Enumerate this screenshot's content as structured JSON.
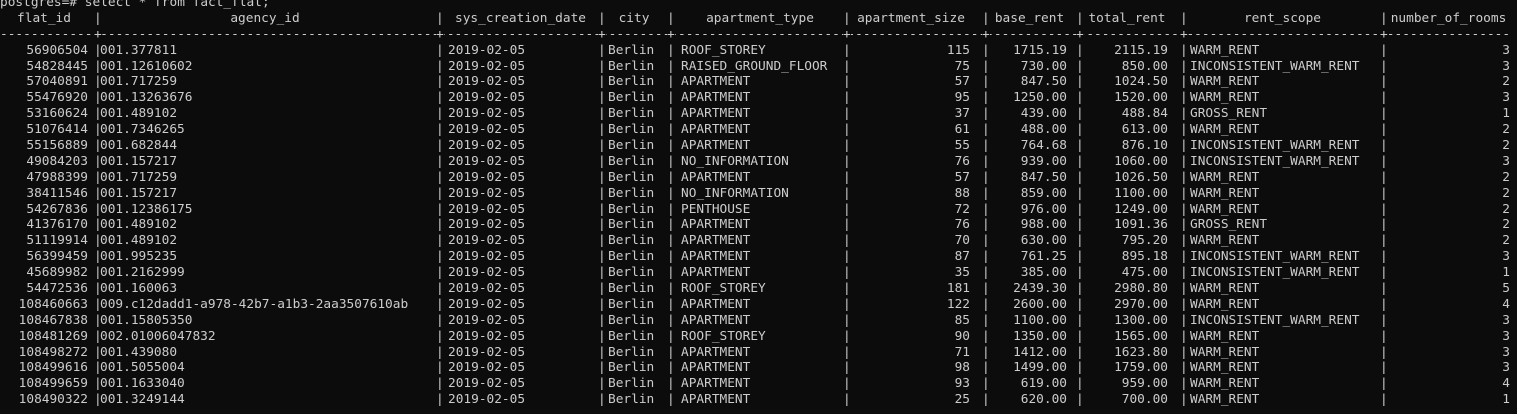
{
  "terminal": {
    "prompt_line": "postgres=# select * from fact_flat;",
    "columns": [
      {
        "key": "flat_id",
        "header": "flat_id"
      },
      {
        "key": "agency_id",
        "header": "agency_id"
      },
      {
        "key": "sys_creation_date",
        "header": "sys_creation_date"
      },
      {
        "key": "city",
        "header": "city"
      },
      {
        "key": "apartment_type",
        "header": "apartment_type"
      },
      {
        "key": "apartment_size",
        "header": "apartment_size"
      },
      {
        "key": "base_rent",
        "header": "base_rent"
      },
      {
        "key": "total_rent",
        "header": "total_rent"
      },
      {
        "key": "rent_scope",
        "header": "rent_scope"
      },
      {
        "key": "number_of_rooms",
        "header": "number_of_rooms"
      }
    ],
    "rows": [
      [
        "56906504",
        "001.377811",
        "2019-02-05",
        "Berlin",
        "ROOF_STOREY",
        "115",
        "1715.19",
        "2115.19",
        "WARM_RENT",
        "3"
      ],
      [
        "54828445",
        "001.12610602",
        "2019-02-05",
        "Berlin",
        "RAISED_GROUND_FLOOR",
        "75",
        "730.00",
        "850.00",
        "INCONSISTENT_WARM_RENT",
        "3"
      ],
      [
        "57040891",
        "001.717259",
        "2019-02-05",
        "Berlin",
        "APARTMENT",
        "57",
        "847.50",
        "1024.50",
        "WARM_RENT",
        "2"
      ],
      [
        "55476920",
        "001.13263676",
        "2019-02-05",
        "Berlin",
        "APARTMENT",
        "95",
        "1250.00",
        "1520.00",
        "WARM_RENT",
        "3"
      ],
      [
        "53160624",
        "001.489102",
        "2019-02-05",
        "Berlin",
        "APARTMENT",
        "37",
        "439.00",
        "488.84",
        "GROSS_RENT",
        "1"
      ],
      [
        "51076414",
        "001.7346265",
        "2019-02-05",
        "Berlin",
        "APARTMENT",
        "61",
        "488.00",
        "613.00",
        "WARM_RENT",
        "2"
      ],
      [
        "55156889",
        "001.682844",
        "2019-02-05",
        "Berlin",
        "APARTMENT",
        "55",
        "764.68",
        "876.10",
        "INCONSISTENT_WARM_RENT",
        "2"
      ],
      [
        "49084203",
        "001.157217",
        "2019-02-05",
        "Berlin",
        "NO_INFORMATION",
        "76",
        "939.00",
        "1060.00",
        "INCONSISTENT_WARM_RENT",
        "3"
      ],
      [
        "47988399",
        "001.717259",
        "2019-02-05",
        "Berlin",
        "APARTMENT",
        "57",
        "847.50",
        "1026.50",
        "WARM_RENT",
        "2"
      ],
      [
        "38411546",
        "001.157217",
        "2019-02-05",
        "Berlin",
        "NO_INFORMATION",
        "88",
        "859.00",
        "1100.00",
        "WARM_RENT",
        "2"
      ],
      [
        "54267836",
        "001.12386175",
        "2019-02-05",
        "Berlin",
        "PENTHOUSE",
        "72",
        "976.00",
        "1249.00",
        "WARM_RENT",
        "2"
      ],
      [
        "41376170",
        "001.489102",
        "2019-02-05",
        "Berlin",
        "APARTMENT",
        "76",
        "988.00",
        "1091.36",
        "GROSS_RENT",
        "2"
      ],
      [
        "51119914",
        "001.489102",
        "2019-02-05",
        "Berlin",
        "APARTMENT",
        "70",
        "630.00",
        "795.20",
        "WARM_RENT",
        "2"
      ],
      [
        "56399459",
        "001.995235",
        "2019-02-05",
        "Berlin",
        "APARTMENT",
        "87",
        "761.25",
        "895.18",
        "INCONSISTENT_WARM_RENT",
        "3"
      ],
      [
        "45689982",
        "001.2162999",
        "2019-02-05",
        "Berlin",
        "APARTMENT",
        "35",
        "385.00",
        "475.00",
        "INCONSISTENT_WARM_RENT",
        "1"
      ],
      [
        "54472536",
        "001.160063",
        "2019-02-05",
        "Berlin",
        "ROOF_STOREY",
        "181",
        "2439.30",
        "2980.80",
        "WARM_RENT",
        "5"
      ],
      [
        "108460663",
        "009.c12dadd1-a978-42b7-a1b3-2aa3507610ab",
        "2019-02-05",
        "Berlin",
        "APARTMENT",
        "122",
        "2600.00",
        "2970.00",
        "WARM_RENT",
        "4"
      ],
      [
        "108467838",
        "001.15805350",
        "2019-02-05",
        "Berlin",
        "APARTMENT",
        "85",
        "1100.00",
        "1300.00",
        "INCONSISTENT_WARM_RENT",
        "3"
      ],
      [
        "108481269",
        "002.01006047832",
        "2019-02-05",
        "Berlin",
        "ROOF_STOREY",
        "90",
        "1350.00",
        "1565.00",
        "WARM_RENT",
        "3"
      ],
      [
        "108498272",
        "001.439080",
        "2019-02-05",
        "Berlin",
        "APARTMENT",
        "71",
        "1412.00",
        "1623.80",
        "WARM_RENT",
        "3"
      ],
      [
        "108499616",
        "001.5055004",
        "2019-02-05",
        "Berlin",
        "APARTMENT",
        "98",
        "1499.00",
        "1759.00",
        "WARM_RENT",
        "3"
      ],
      [
        "108499659",
        "001.1633040",
        "2019-02-05",
        "Berlin",
        "APARTMENT",
        "93",
        "619.00",
        "959.00",
        "WARM_RENT",
        "4"
      ],
      [
        "108490322",
        "001.3249144",
        "2019-02-05",
        "Berlin",
        "APARTMENT",
        "25",
        "620.00",
        "700.00",
        "WARM_RENT",
        "1"
      ]
    ],
    "colors": {
      "background": "#0c0c0c",
      "foreground": "#cccccc"
    }
  }
}
